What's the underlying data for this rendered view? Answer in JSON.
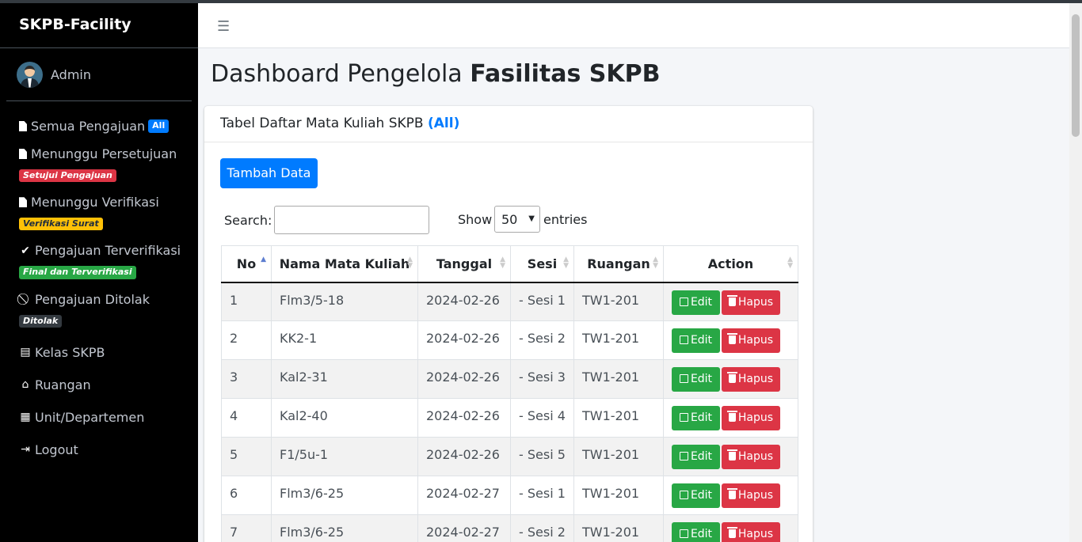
{
  "sidebar": {
    "brand": "SKPB-Facility",
    "user": "Admin",
    "items": [
      {
        "label": "Semua Pengajuan",
        "badge": "All",
        "icon": "file-icon"
      },
      {
        "label": "Menunggu Persetujuan",
        "badge": "Setujui Pengajuan",
        "icon": "file-icon"
      },
      {
        "label": "Menunggu Verifikasi",
        "badge": "Verifikasi Surat",
        "icon": "file-icon"
      },
      {
        "label": "Pengajuan Terverifikasi",
        "badge": "Final dan Terverifikasi",
        "icon": "check-icon"
      },
      {
        "label": "Pengajuan Ditolak",
        "badge": "Ditolak",
        "icon": "ban-icon"
      },
      {
        "label": "Kelas SKPB",
        "icon": "book-icon"
      },
      {
        "label": "Ruangan",
        "icon": "home-icon"
      },
      {
        "label": "Unit/Departemen",
        "icon": "building-icon"
      },
      {
        "label": "Logout",
        "icon": "logout-icon"
      }
    ]
  },
  "page": {
    "title_prefix": "Dashboard Pengelola ",
    "title_bold": "Fasilitas SKPB"
  },
  "card": {
    "header": "Tabel Daftar Mata Kuliah SKPB ",
    "header_highlight": "(All)",
    "add_button": "Tambah Data",
    "search_label": "Search:",
    "show_label": "Show",
    "show_value": "50",
    "entries_label": "entries"
  },
  "table": {
    "columns": [
      "No",
      "Nama Mata Kuliah",
      "Tanggal",
      "Sesi",
      "Ruangan",
      "Action"
    ],
    "edit_label": "Edit",
    "delete_label": "Hapus",
    "rows": [
      [
        "1",
        "Flm3/5-18",
        "2024-02-26",
        "- Sesi 1",
        "TW1-201"
      ],
      [
        "2",
        "KK2-1",
        "2024-02-26",
        "- Sesi 2",
        "TW1-201"
      ],
      [
        "3",
        "Kal2-31",
        "2024-02-26",
        "- Sesi 3",
        "TW1-201"
      ],
      [
        "4",
        "Kal2-40",
        "2024-02-26",
        "- Sesi 4",
        "TW1-201"
      ],
      [
        "5",
        "F1/5u-1",
        "2024-02-26",
        "- Sesi 5",
        "TW1-201"
      ],
      [
        "6",
        "Flm3/6-25",
        "2024-02-27",
        "- Sesi 1",
        "TW1-201"
      ],
      [
        "7",
        "Flm3/6-25",
        "2024-02-27",
        "- Sesi 2",
        "TW1-201"
      ]
    ]
  }
}
